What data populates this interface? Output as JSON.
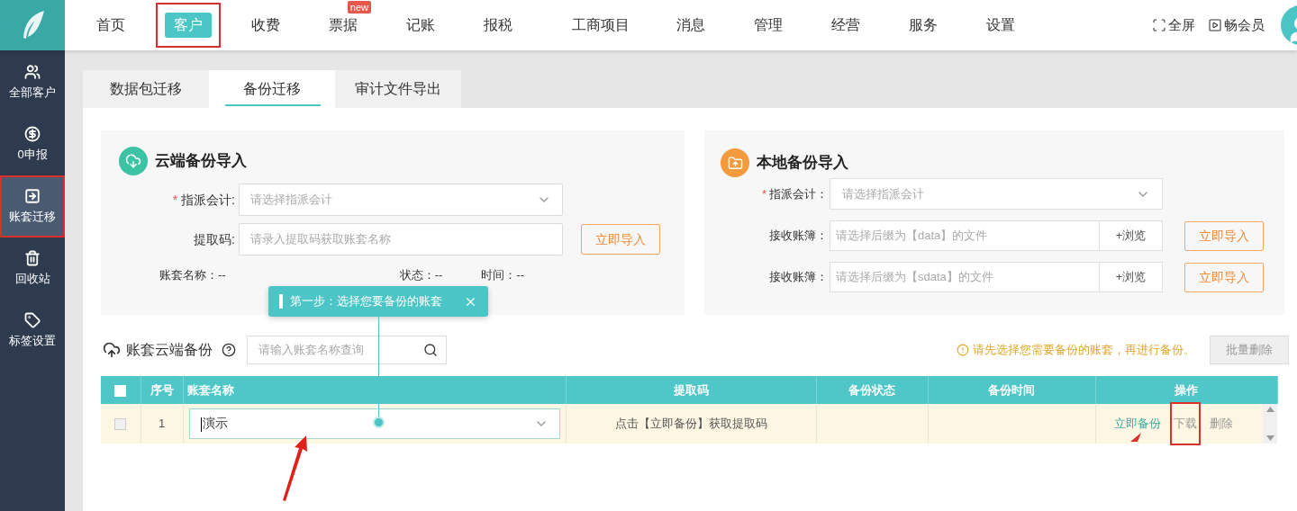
{
  "nav": [
    {
      "label": "首页",
      "selected": false,
      "highlighted": false
    },
    {
      "label": "客户",
      "selected": true,
      "highlighted": true
    },
    {
      "label": "收费",
      "selected": false,
      "highlighted": false
    },
    {
      "label": "票据",
      "selected": false,
      "highlighted": false,
      "badge": "new"
    },
    {
      "label": "记账",
      "selected": false,
      "highlighted": false
    },
    {
      "label": "报税",
      "selected": false,
      "highlighted": false
    },
    {
      "label": "工商项目",
      "selected": false,
      "highlighted": false
    },
    {
      "label": "消息",
      "selected": false,
      "highlighted": false
    },
    {
      "label": "管理",
      "selected": false,
      "highlighted": false
    },
    {
      "label": "经营",
      "selected": false,
      "highlighted": false
    },
    {
      "label": "服务",
      "selected": false,
      "highlighted": false
    },
    {
      "label": "设置",
      "selected": false,
      "highlighted": false
    }
  ],
  "top_actions": [
    {
      "label": "全屏",
      "kind": "fullscreen"
    },
    {
      "label": "畅会员",
      "kind": "video"
    }
  ],
  "sidebar": [
    {
      "label": "全部客户",
      "kind": "users",
      "selected": false,
      "highlighted": false
    },
    {
      "label": "0申报",
      "kind": "coin",
      "selected": false,
      "highlighted": false
    },
    {
      "label": "账套迁移",
      "kind": "export",
      "selected": true,
      "highlighted": true
    },
    {
      "label": "回收站",
      "kind": "trash",
      "selected": false,
      "highlighted": false
    },
    {
      "label": "标签设置",
      "kind": "tag",
      "selected": false,
      "highlighted": false
    }
  ],
  "tabs": [
    {
      "label": "数据包迁移",
      "selected": false
    },
    {
      "label": "备份迁移",
      "selected": true
    },
    {
      "label": "审计文件导出",
      "selected": false
    }
  ],
  "cloud_import": {
    "title": "云端备份导入",
    "fields": [
      {
        "label": "指派会计:",
        "required_mark": "*",
        "kind": "select",
        "placeholder": "请选择指派会计"
      },
      {
        "label": "提取码:",
        "kind": "text",
        "placeholder": "请录入提取码获取账套名称",
        "button": "立即导入"
      }
    ],
    "info": [
      {
        "label": "账套名称：",
        "value": "--"
      },
      {
        "label": "状态：",
        "value": "--"
      },
      {
        "label": "时间：",
        "value": "--"
      }
    ]
  },
  "local_import": {
    "title": "本地备份导入",
    "select": {
      "label": "指派会计：",
      "required_mark": "*",
      "placeholder": "请选择指派会计"
    },
    "files": [
      {
        "label": "接收账簿：",
        "placeholder": "请选择后缀为【data】的文件",
        "browse": "+浏览",
        "button": "立即导入"
      },
      {
        "label": "接收账簿：",
        "placeholder": "请选择后缀为【sdata】的文件",
        "browse": "+浏览",
        "button": "立即导入"
      }
    ]
  },
  "guide": {
    "text": "第一步：选择您要备份的账套"
  },
  "backup": {
    "title": "账套云端备份",
    "search_placeholder": "请输入账套名称查询",
    "notice": "请先选择您需要备份的账套，再进行备份。",
    "batch_button": "批量删除",
    "all_checked": false,
    "columns": [
      "序号",
      "账套名称",
      "提取码",
      "备份状态",
      "备份时间",
      "操作"
    ],
    "rows": [
      {
        "checked": false,
        "index": "1",
        "name": "演示",
        "code": "点击【立即备份】获取提取码",
        "actions": [
          {
            "label": "立即备份",
            "kind": "primary",
            "highlighted": false
          },
          {
            "label": "下载",
            "kind": "default",
            "highlighted": true
          },
          {
            "label": "删除",
            "kind": "default",
            "highlighted": false
          }
        ]
      }
    ]
  }
}
